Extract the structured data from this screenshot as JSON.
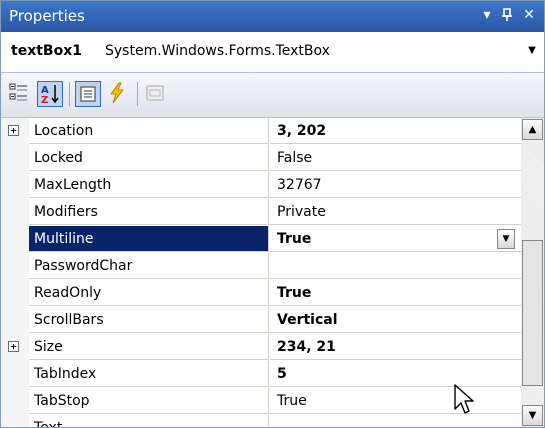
{
  "window": {
    "title": "Properties",
    "dropdown_glyph": "▾",
    "pin_glyph": "Ⴔ",
    "close_glyph": "✕"
  },
  "object_selector": {
    "name": "textBox1",
    "type": "System.Windows.Forms.TextBox",
    "drop_glyph": "▼"
  },
  "toolbar": {
    "buttons": [
      {
        "name": "categorized-icon",
        "checked": false
      },
      {
        "name": "alphabetical-icon",
        "checked": true
      },
      {
        "name": "properties-icon",
        "checked": true
      },
      {
        "name": "events-icon",
        "checked": false
      },
      {
        "name": "property-pages-icon",
        "checked": false
      }
    ]
  },
  "grid": {
    "rows": [
      {
        "name": "Location",
        "value": "3, 202",
        "bold": true,
        "expandable": true
      },
      {
        "name": "Locked",
        "value": "False",
        "bold": false
      },
      {
        "name": "MaxLength",
        "value": "32767",
        "bold": false
      },
      {
        "name": "Modifiers",
        "value": "Private",
        "bold": false
      },
      {
        "name": "Multiline",
        "value": "True",
        "bold": true,
        "selected": true,
        "dropdown": true
      },
      {
        "name": "PasswordChar",
        "value": "",
        "bold": false
      },
      {
        "name": "ReadOnly",
        "value": "True",
        "bold": true
      },
      {
        "name": "ScrollBars",
        "value": "Vertical",
        "bold": true
      },
      {
        "name": "Size",
        "value": "234, 21",
        "bold": true,
        "expandable": true
      },
      {
        "name": "TabIndex",
        "value": "5",
        "bold": true
      },
      {
        "name": "TabStop",
        "value": "True",
        "bold": false
      },
      {
        "name": "Text",
        "value": "",
        "bold": false
      }
    ],
    "expander_glyph": "+",
    "dropdown_glyph": "▼"
  },
  "scrollbar": {
    "up_glyph": "▲",
    "down_glyph": "▼"
  },
  "colors": {
    "title_bar": "#2e62b5",
    "selected_row": "#0a246a",
    "selected_text": "#ffffff"
  }
}
